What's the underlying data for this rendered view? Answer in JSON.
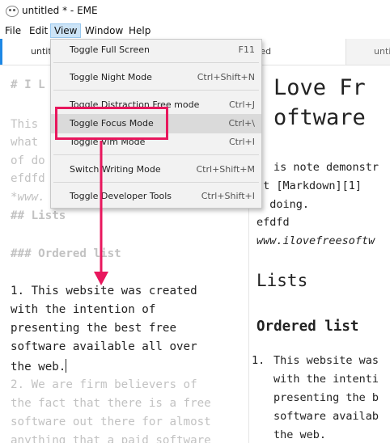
{
  "window": {
    "title": "untitled * - EME"
  },
  "menubar": {
    "items": [
      "File",
      "Edit",
      "View",
      "Window",
      "Help"
    ]
  },
  "tabs": [
    {
      "label": "untit"
    },
    {
      "label": "tled",
      "modified": true
    },
    {
      "label": "unti"
    }
  ],
  "view_menu": [
    {
      "label": "Toggle Full Screen",
      "shortcut": "F11"
    },
    {
      "label": "Toggle Night Mode",
      "shortcut": "Ctrl+Shift+N"
    },
    {
      "label": "Toggle Distraction Free mode",
      "shortcut": "Ctrl+J"
    },
    {
      "label": "Toggle Focus Mode",
      "shortcut": "Ctrl+\\"
    },
    {
      "label": "Toggle Vim Mode",
      "shortcut": "Ctrl+I"
    },
    {
      "label": "Switch Writing Mode",
      "shortcut": "Ctrl+Shift+M"
    },
    {
      "label": "Toggle Developer Tools",
      "shortcut": "Ctrl+Shift+I"
    }
  ],
  "editor": {
    "lines": [
      "# I L",
      "This",
      "what",
      "of do",
      "efdfd",
      "*www.",
      "## Lists",
      "### Ordered list",
      "1. This website was created",
      "with the intention of",
      "presenting the best free",
      "software available all over",
      "the web.",
      "2. We are firm believers of",
      "the fact that there is a free",
      "software out there for almost",
      "anything that a paid software"
    ]
  },
  "preview": {
    "h1_line1": "Love Fr",
    "h1_line2": "oftware",
    "p_lines": [
      "is note demonstr",
      "at [Markdown][1]",
      "f doing.",
      "efdfd"
    ],
    "link": "www.ilovefreesoftw",
    "h2": "Lists",
    "h3": "Ordered list",
    "list_marker": "1.",
    "list_lines": [
      "This website was",
      "with the intenti",
      "presenting the b",
      "software availab",
      "the web."
    ]
  },
  "colors": {
    "accent": "#1e88e5",
    "annotation": "#e8175d",
    "menu_highlight": "#cce4f7"
  }
}
